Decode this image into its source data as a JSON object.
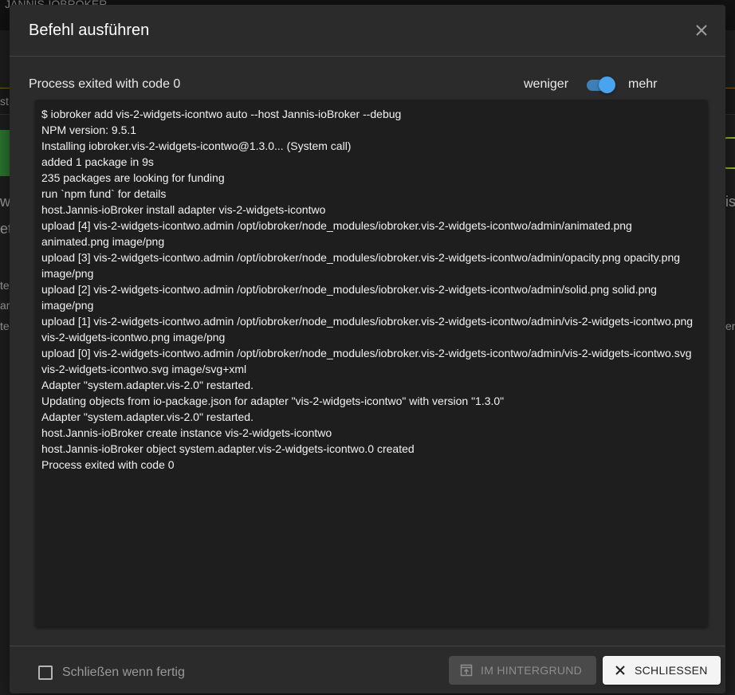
{
  "background": {
    "app_title": "JANNIS-IOBROKER",
    "tab_fragment": "st",
    "side_fragments": [
      "w",
      "et",
      "te",
      "are",
      "te"
    ],
    "right_fragments": [
      "is",
      "en"
    ]
  },
  "dialog": {
    "title": "Befehl ausführen",
    "close_icon": "close-icon",
    "status": "Process exited with code 0",
    "toggle": {
      "less_label": "weniger",
      "more_label": "mehr",
      "checked": true,
      "accent_color": "#4aa3ee"
    },
    "log_lines": [
      "$ iobroker add vis-2-widgets-icontwo auto --host Jannis-ioBroker --debug",
      "NPM version: 9.5.1",
      "Installing iobroker.vis-2-widgets-icontwo@1.3.0... (System call)",
      "added 1 package in 9s",
      "235 packages are looking for funding",
      "run `npm fund` for details",
      "host.Jannis-ioBroker install adapter vis-2-widgets-icontwo",
      "upload [4] vis-2-widgets-icontwo.admin /opt/iobroker/node_modules/iobroker.vis-2-widgets-icontwo/admin/animated.png animated.png image/png",
      "upload [3] vis-2-widgets-icontwo.admin /opt/iobroker/node_modules/iobroker.vis-2-widgets-icontwo/admin/opacity.png opacity.png image/png",
      "upload [2] vis-2-widgets-icontwo.admin /opt/iobroker/node_modules/iobroker.vis-2-widgets-icontwo/admin/solid.png solid.png image/png",
      "upload [1] vis-2-widgets-icontwo.admin /opt/iobroker/node_modules/iobroker.vis-2-widgets-icontwo/admin/vis-2-widgets-icontwo.png vis-2-widgets-icontwo.png image/png",
      "upload [0] vis-2-widgets-icontwo.admin /opt/iobroker/node_modules/iobroker.vis-2-widgets-icontwo/admin/vis-2-widgets-icontwo.svg vis-2-widgets-icontwo.svg image/svg+xml",
      "Adapter \"system.adapter.vis-2.0\" restarted.",
      "Updating objects from io-package.json for adapter \"vis-2-widgets-icontwo\" with version \"1.3.0\"",
      "Adapter \"system.adapter.vis-2.0\" restarted.",
      "host.Jannis-ioBroker create instance vis-2-widgets-icontwo",
      "host.Jannis-ioBroker object system.adapter.vis-2-widgets-icontwo.0 created",
      "Process exited with code 0"
    ],
    "footer": {
      "close_when_done_label": "Schließen wenn fertig",
      "close_when_done_checked": false,
      "background_button": {
        "label": "IM HINTERGRUND",
        "icon": "open-in-background-icon",
        "disabled": true
      },
      "close_button": {
        "label": "SCHLIESSEN",
        "icon": "close-icon"
      }
    }
  }
}
